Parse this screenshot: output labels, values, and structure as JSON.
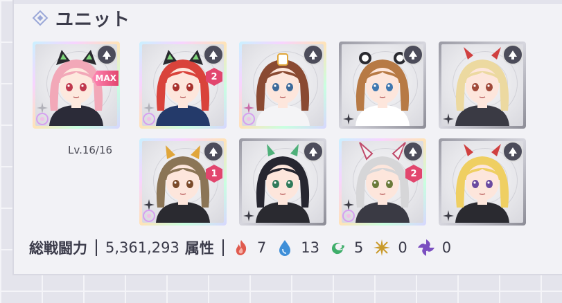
{
  "title": "ユニット",
  "level_text": "Lv.16/16",
  "stats": {
    "power_label": "総戦闘力",
    "power_value": "5,361,293",
    "attr_label": "属性",
    "elements": [
      {
        "icon": "fire-icon",
        "count": "7",
        "color": "#e05a4e"
      },
      {
        "icon": "water-icon",
        "count": "13",
        "color": "#3f8fd8"
      },
      {
        "icon": "wind-icon",
        "count": "5",
        "color": "#3fae6a"
      },
      {
        "icon": "light-icon",
        "count": "0",
        "color": "#c99a2a"
      },
      {
        "icon": "dark-icon",
        "count": "0",
        "color": "#7b4fc0"
      }
    ]
  },
  "units": [
    {
      "hair": "#f2a8b8",
      "skin": "#fde9de",
      "eyes": "#c0394e",
      "frame": "rainbow",
      "badge": "MAX",
      "accessory": "cat-ears",
      "elem": "light",
      "outfit": "#2b2b38"
    },
    {
      "hair": "#d9433b",
      "skin": "#fde6dc",
      "eyes": "#a8322e",
      "frame": "rainbow",
      "badge": "2",
      "accessory": "cat-ears",
      "elem": "light",
      "outfit": "#243a6a"
    },
    {
      "hair": "#8a4a32",
      "skin": "#fde6dc",
      "eyes": "#3c6a9a",
      "frame": "rainbow",
      "badge": "",
      "accessory": "headband",
      "elem": "dark",
      "outfit": "#f4f4f6"
    },
    {
      "hair": "#b77a45",
      "skin": "#fde6dc",
      "eyes": "#3f78b0",
      "frame": "silver",
      "badge": "",
      "accessory": "bear-ears",
      "elem": "dark",
      "outfit": "#ffffff"
    },
    {
      "hair": "#ecd9a0",
      "skin": "#fde6dc",
      "eyes": "#a04a3a",
      "frame": "silver",
      "badge": "",
      "accessory": "horns",
      "elem": "dark",
      "outfit": "#3a3a44"
    },
    {
      "hair": "#8b7556",
      "skin": "#fde6dc",
      "eyes": "#7a4a2a",
      "frame": "rainbow",
      "badge": "1",
      "accessory": "gold-horns",
      "elem": "dark",
      "outfit": "#2a2a30"
    },
    {
      "hair": "#262630",
      "skin": "#fde6dc",
      "eyes": "#2f7a5a",
      "frame": "silver",
      "badge": "",
      "accessory": "green-horns",
      "elem": "dark",
      "outfit": "#2a2a30"
    },
    {
      "hair": "#d6d6d8",
      "skin": "#fde6dc",
      "eyes": "#6a7a3a",
      "frame": "rainbow",
      "badge": "2",
      "accessory": "bunny-ears",
      "elem": "dark",
      "outfit": "#3a3a44"
    },
    {
      "hair": "#efcf62",
      "skin": "#fde6dc",
      "eyes": "#6a4aa0",
      "frame": "silver",
      "badge": "",
      "accessory": "horns",
      "elem": "dark",
      "outfit": "#2a2a30"
    }
  ]
}
